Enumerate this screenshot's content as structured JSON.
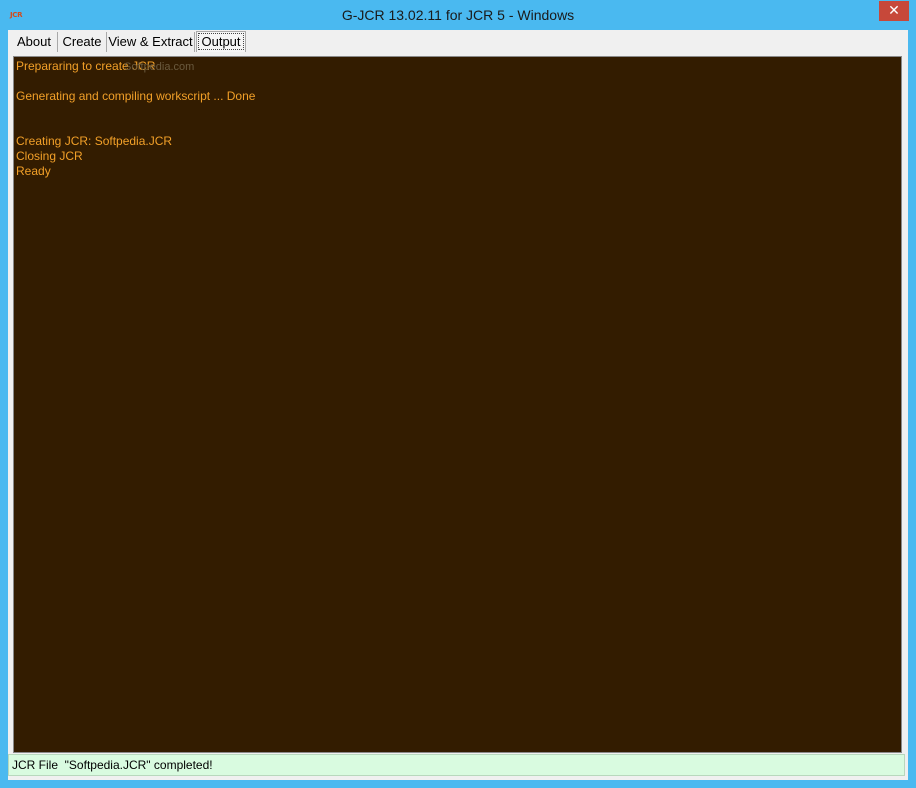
{
  "window": {
    "title": "G-JCR 13.02.11 for JCR 5 - Windows",
    "icon": "jcr-app-icon",
    "icon_text_left": "JC",
    "icon_text_right": "R",
    "close_glyph": "✕",
    "accent_color": "#4ab9f0",
    "close_color": "#c7483a"
  },
  "tabs": [
    {
      "label": "About"
    },
    {
      "label": "Create"
    },
    {
      "label": "View & Extract"
    },
    {
      "label": "Output",
      "active": true
    }
  ],
  "output": {
    "background": "#331c00",
    "text_color": "#f2a028",
    "lines": [
      "Prepararing to create JCR",
      "",
      "Generating and compiling workscript ... Done",
      "",
      "",
      "Creating JCR: Softpedia.JCR",
      "Closing JCR",
      "Ready"
    ],
    "watermark": "Softpedia.com"
  },
  "status": {
    "text": "JCR File  \"Softpedia.JCR\" completed!",
    "background": "#d9fbe0"
  }
}
